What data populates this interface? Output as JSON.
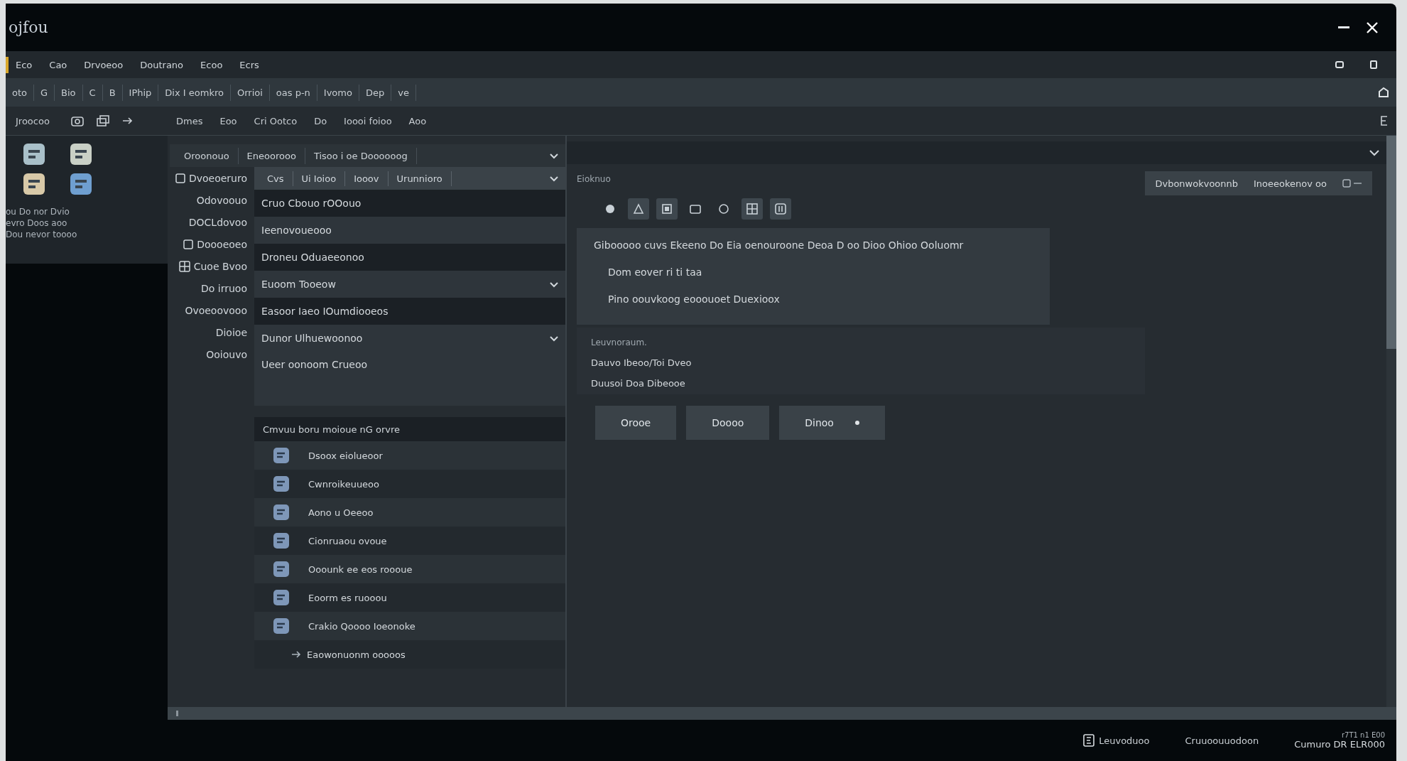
{
  "window": {
    "title": "ojfou"
  },
  "menu_bar": {
    "items": [
      {
        "label": "Eco",
        "selected": true
      },
      {
        "label": "Cao",
        "selected": false
      },
      {
        "label": "Drvoeoo",
        "selected": false
      },
      {
        "label": "Doutrano",
        "selected": false
      },
      {
        "label": "Ecoo",
        "selected": false
      },
      {
        "label": "Ecrs",
        "selected": false
      }
    ]
  },
  "toolbar": {
    "items": [
      "oto",
      "G",
      "Bio",
      "C",
      "B",
      "IPhip",
      "Dix I eomkro",
      "Orrioi",
      "oas p-n",
      "Ivomo",
      "Dep",
      "ve"
    ]
  },
  "secondary_toolbar": {
    "label": "Jroocoo",
    "items": [
      "Dmes",
      "Eoo",
      "Cri Ootco",
      "Do",
      "Ioooi foioo",
      "Aoo"
    ]
  },
  "left_panel": {
    "labels": [
      "ou Do nor Dvio",
      "evro Doos aoo",
      "Dou nevor toooo"
    ]
  },
  "filter_bar": {
    "tabs": [
      "Oroonouo",
      "Eneoorooo",
      "Tisoo i oe Doooooog"
    ]
  },
  "sidebar": {
    "items": [
      {
        "label": "Dvoeoeruro",
        "kind": "checkbox",
        "checked": false
      },
      {
        "label": "Odovoouo",
        "kind": "plain"
      },
      {
        "label": "DOCLdovoo",
        "kind": "plain"
      },
      {
        "label": "Doooeoeo",
        "kind": "checkbox",
        "checked": false
      },
      {
        "label": "Cuoe Bvoo",
        "kind": "icon"
      },
      {
        "label": "Do irruoo",
        "kind": "plain"
      },
      {
        "label": "Ovoeoovooo",
        "kind": "plain"
      },
      {
        "label": "Dioioe",
        "kind": "plain"
      },
      {
        "label": "Ooiouvo",
        "kind": "plain"
      }
    ]
  },
  "settings": {
    "tabs": [
      "Cvs",
      "Ui Ioioo",
      "Iooov",
      "Urunnioro"
    ],
    "rows": [
      {
        "text": "Cruo Cbouo rOOouo",
        "dropdown": false
      },
      {
        "text": "Ieenovoueooo",
        "dropdown": false
      },
      {
        "text": "Droneu Oduaeeonoo",
        "dropdown": false
      },
      {
        "text": "Euoom Tooeow",
        "dropdown": true
      },
      {
        "text": "Easoor Iaeo IOumdiooeos",
        "dropdown": false
      },
      {
        "text": "Dunor Ulhuewoonoo",
        "dropdown": true
      },
      {
        "text": "Ueer oonoom Crueoo",
        "dropdown": false
      }
    ]
  },
  "list": {
    "title": "Cmvuu boru moioue nG orvre",
    "items": [
      {
        "label": "Dsoox eiolueoor",
        "kind": "app"
      },
      {
        "label": "Cwnroikeuueoo",
        "kind": "app"
      },
      {
        "label": "Aono u Oeeoo",
        "kind": "app"
      },
      {
        "label": "Cionruaou ovoue",
        "kind": "app"
      },
      {
        "label": "Ooounk ee eos roooue",
        "kind": "app"
      },
      {
        "label": "Eoorm es ruooou",
        "kind": "app"
      },
      {
        "label": "Crakio Qoooo Ioeonoke",
        "kind": "app"
      },
      {
        "label": "Eaowonuonm ooooos",
        "kind": "sub"
      }
    ]
  },
  "details": {
    "label": "Eioknuo",
    "tools": [
      {
        "selected": false
      },
      {
        "selected": true
      },
      {
        "selected": true
      },
      {
        "selected": false
      },
      {
        "selected": false
      },
      {
        "selected": true
      },
      {
        "selected": true
      }
    ],
    "lines": [
      "Gibooooo cuvs Ekeeno Do Eia oenouroone Deoa D oo Dioo Ohioo Ooluomr",
      "Dom eover ri ti taa",
      "Pino oouvkoog eooouoet Duexioox"
    ],
    "section_label": "Leuvnoraum.",
    "section_lines": [
      "Dauvo Ibeoo/Toi Dveo",
      "Duusoi Doa Dibeooe"
    ],
    "buttons": [
      {
        "label": "Orooe",
        "dropdown": false
      },
      {
        "label": "Doooo",
        "dropdown": false
      },
      {
        "label": "Dinoo",
        "dropdown": true
      }
    ]
  },
  "badge": {
    "items": [
      "Dvbonwokvoonnb",
      "Inoeeokenov oo"
    ]
  },
  "status_bar": {
    "items": [
      "Leuvoduoo",
      "Cruuoouuodoon",
      "Cumuro DR ELR000"
    ],
    "corner": "r7T1 n1 E00"
  }
}
